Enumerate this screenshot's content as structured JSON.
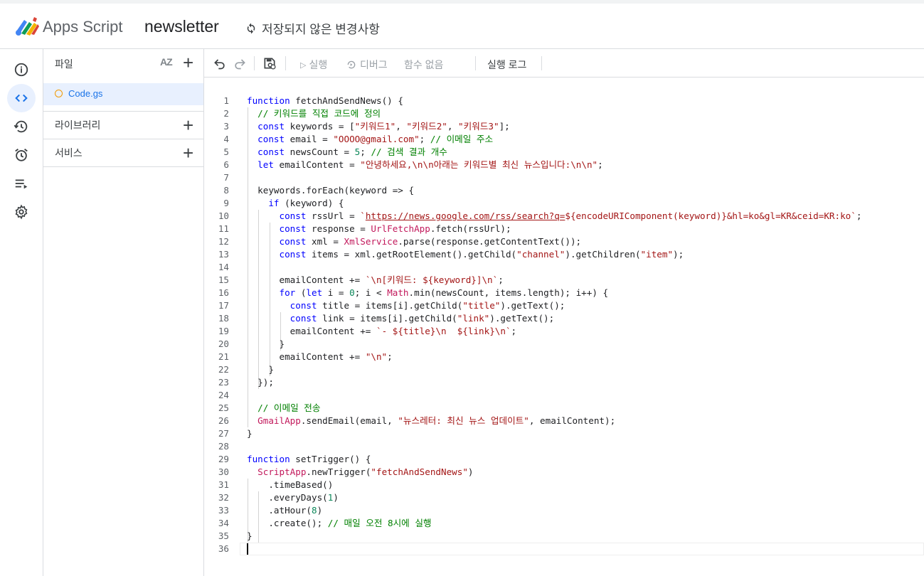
{
  "header": {
    "app_name": "Apps Script",
    "project_name": "newsletter",
    "save_status": "저장되지 않은 변경사항"
  },
  "rail": {
    "items": [
      {
        "icon": "info-icon",
        "label": "개요"
      },
      {
        "icon": "code-icon",
        "label": "편집기",
        "active": true
      },
      {
        "icon": "history-icon",
        "label": "실행 기록"
      },
      {
        "icon": "alarm-icon",
        "label": "트리거"
      },
      {
        "icon": "executions-icon",
        "label": "실행"
      },
      {
        "icon": "gear-icon",
        "label": "프로젝트 설정"
      }
    ]
  },
  "files_panel": {
    "files_title": "파일",
    "sort_label": "AZ",
    "file": {
      "name": "Code.gs"
    },
    "libraries_title": "라이브러리",
    "services_title": "서비스"
  },
  "toolbar": {
    "run_label": "실행",
    "debug_label": "디버그",
    "function_select": "함수 없음",
    "exec_log_label": "실행 로그"
  },
  "editor": {
    "cursor_line": 36,
    "lines": [
      "function fetchAndSendNews() {",
      "  // 키워드를 직접 코드에 정의",
      "  const keywords = [\"키워드1\", \"키워드2\", \"키워드3\"];",
      "  const email = \"OOOO@gmail.com\"; // 이메일 주소",
      "  const newsCount = 5; // 검색 결과 개수",
      "  let emailContent = \"안녕하세요,\\n\\n아래는 키워드별 최신 뉴스입니다:\\n\\n\";",
      "",
      "  keywords.forEach(keyword => {",
      "    if (keyword) {",
      "      const rssUrl = `https://news.google.com/rss/search?q=${encodeURIComponent(keyword)}&hl=ko&gl=KR&ceid=KR:ko`;",
      "      const response = UrlFetchApp.fetch(rssUrl);",
      "      const xml = XmlService.parse(response.getContentText());",
      "      const items = xml.getRootElement().getChild(\"channel\").getChildren(\"item\");",
      "",
      "      emailContent += `\\n[키워드: ${keyword}]\\n`;",
      "      for (let i = 0; i < Math.min(newsCount, items.length); i++) {",
      "        const title = items[i].getChild(\"title\").getText();",
      "        const link = items[i].getChild(\"link\").getText();",
      "        emailContent += `- ${title}\\n  ${link}\\n`;",
      "      }",
      "      emailContent += \"\\n\";",
      "    }",
      "  });",
      "",
      "  // 이메일 전송",
      "  GmailApp.sendEmail(email, \"뉴스레터: 최신 뉴스 업데이트\", emailContent);",
      "}",
      "",
      "function setTrigger() {",
      "  ScriptApp.newTrigger(\"fetchAndSendNews\")",
      "    .timeBased()",
      "    .everyDays(1)",
      "    .atHour(8)",
      "    .create(); // 매일 오전 8시에 실행",
      "}",
      ""
    ]
  }
}
